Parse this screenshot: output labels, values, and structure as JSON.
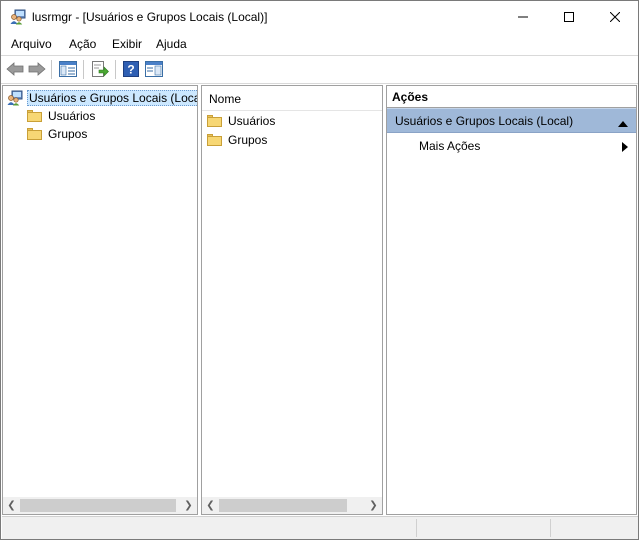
{
  "window": {
    "title": "lusrmgr - [Usuários e Grupos Locais (Local)]",
    "app_icon": "users-computer-icon",
    "controls": [
      "minimize-icon",
      "maximize-icon",
      "close-icon"
    ]
  },
  "menu": {
    "items": [
      "Arquivo",
      "Ação",
      "Exibir",
      "Ajuda"
    ]
  },
  "toolbar": {
    "buttons": [
      "back-arrow-icon",
      "forward-arrow-icon",
      "show-hide-tree-icon",
      "export-list-icon",
      "help-icon",
      "show-hide-action-pane-icon"
    ]
  },
  "tree": {
    "root_label": "Usuários e Grupos Locais (Local)",
    "children": [
      "Usuários",
      "Grupos"
    ]
  },
  "list": {
    "column_header": "Nome",
    "items": [
      "Usuários",
      "Grupos"
    ]
  },
  "actions": {
    "header": "Ações",
    "group_title": "Usuários e Grupos Locais (Local)",
    "items": [
      "Mais Ações"
    ]
  },
  "colors": {
    "selection": "#cce8ff",
    "actions_group": "#9fb8d8",
    "folder": "#f7d774"
  }
}
